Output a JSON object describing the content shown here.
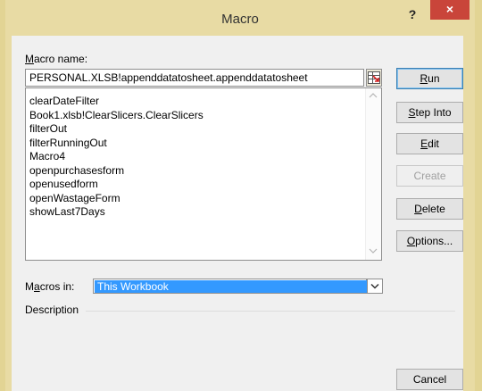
{
  "window": {
    "title": "Macro",
    "help_label": "?",
    "close_label": "×"
  },
  "macro_name": {
    "label_prefix": "M",
    "label_rest": "acro name:",
    "value": "PERSONAL.XLSB!appenddatatosheet.appenddatatosheet"
  },
  "macro_list": [
    "clearDateFilter",
    "Book1.xlsb!ClearSlicers.ClearSlicers",
    "filterOut",
    "filterRunningOut",
    "Macro4",
    "openpurchasesform",
    "openusedform",
    "openWastageForm",
    "showLast7Days"
  ],
  "buttons": {
    "run": {
      "hotkey": "R",
      "rest": "un"
    },
    "step_into": {
      "hotkey": "S",
      "rest": "tep Into"
    },
    "edit": {
      "hotkey": "E",
      "rest": "dit"
    },
    "create": {
      "label": "Create"
    },
    "delete": {
      "hotkey": "D",
      "rest": "elete"
    },
    "options": {
      "hotkey": "O",
      "rest": "ptions..."
    },
    "cancel": {
      "label": "Cancel"
    }
  },
  "macros_in": {
    "label_prefix": "M",
    "label_hot": "a",
    "label_rest": "cros in:",
    "selected": "This Workbook"
  },
  "description": {
    "label": "Description"
  },
  "colors": {
    "title_bar": "#e8dba4",
    "close_button": "#c9453a",
    "selection": "#3399ff"
  }
}
